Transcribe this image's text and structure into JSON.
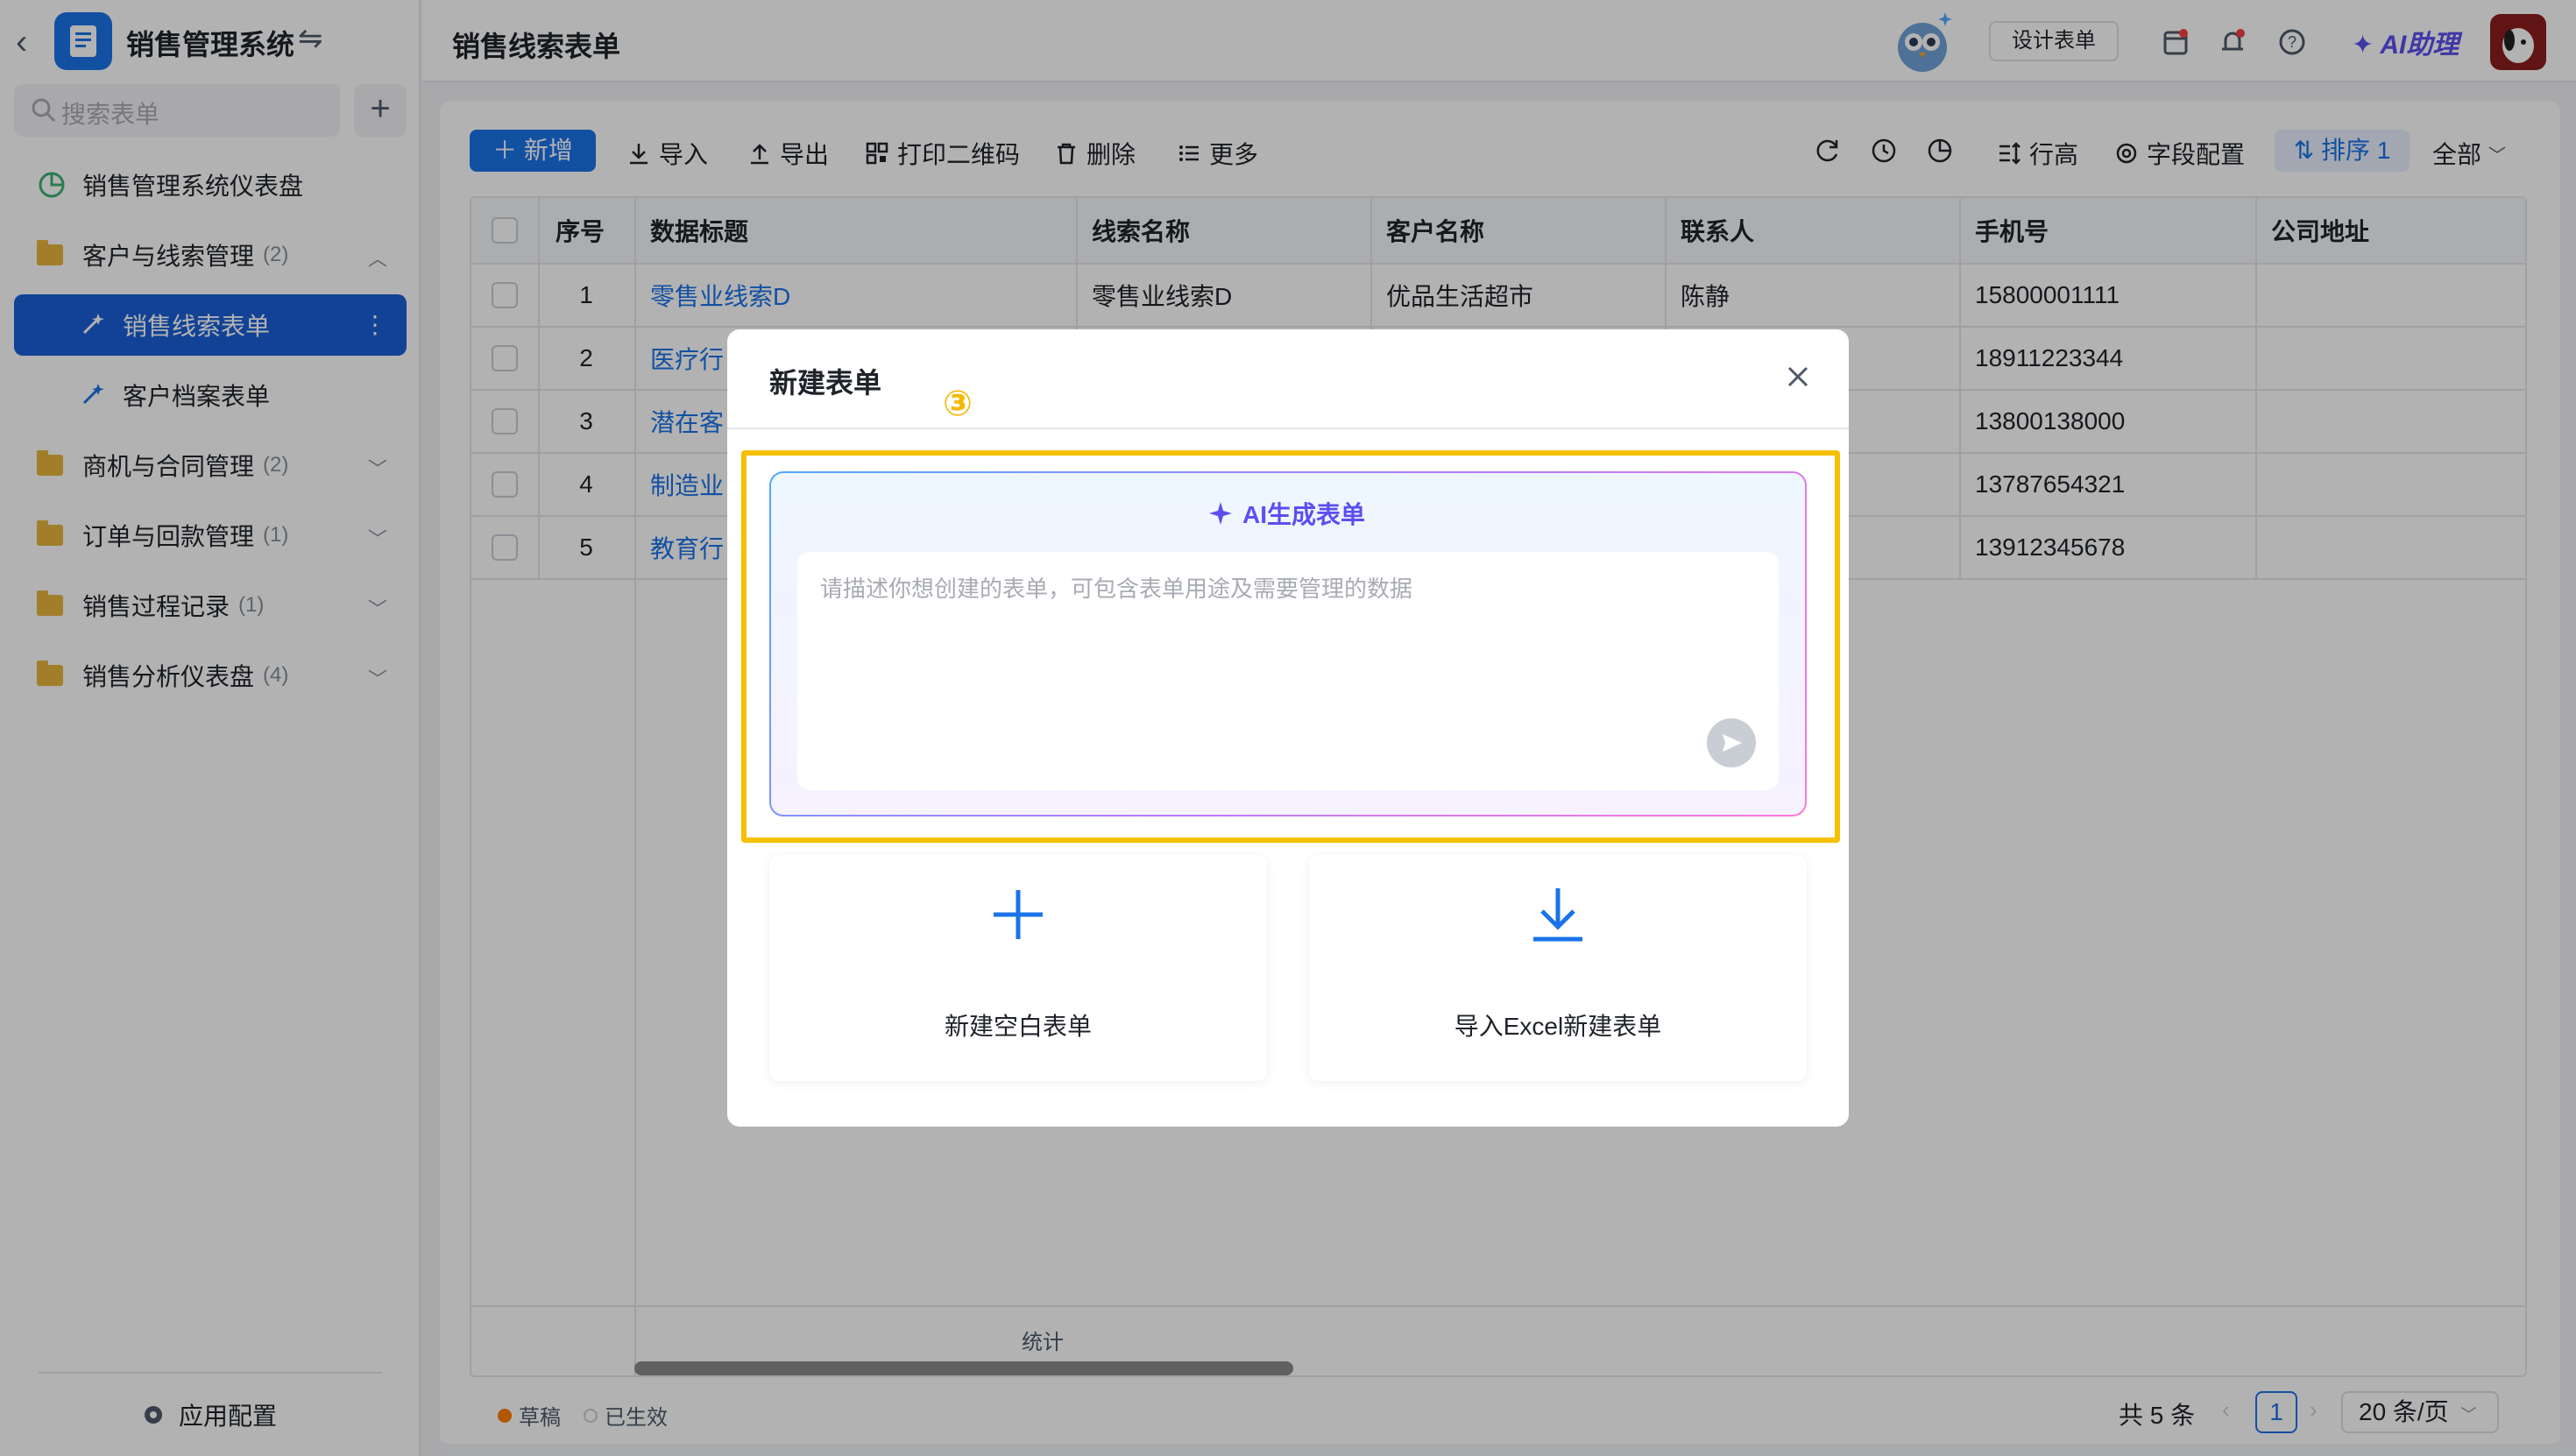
{
  "app": {
    "title": "销售管理系统",
    "search_placeholder": "搜索表单",
    "footer_label": "应用配置"
  },
  "sidebar": {
    "items": [
      {
        "label": "销售管理系统仪表盘",
        "count": ""
      },
      {
        "label": "客户与线索管理",
        "count": "(2)"
      },
      {
        "label": "销售线索表单",
        "count": ""
      },
      {
        "label": "客户档案表单",
        "count": ""
      },
      {
        "label": "商机与合同管理",
        "count": "(2)"
      },
      {
        "label": "订单与回款管理",
        "count": "(1)"
      },
      {
        "label": "销售过程记录",
        "count": "(1)"
      },
      {
        "label": "销售分析仪表盘",
        "count": "(4)"
      }
    ]
  },
  "header": {
    "page_title": "销售线索表单",
    "design_button": "设计表单",
    "ai_assistant": "AI助理"
  },
  "toolbar": {
    "new": "＋ 新增",
    "import": "导入",
    "export": "导出",
    "print_qr": "打印二维码",
    "delete": "删除",
    "more": "更多",
    "row_height": "行高",
    "field_config": "字段配置",
    "sort": "排序 1",
    "filter_all": "全部"
  },
  "table": {
    "columns": [
      "序号",
      "数据标题",
      "线索名称",
      "客户名称",
      "联系人",
      "手机号",
      "公司地址"
    ],
    "rows": [
      [
        "1",
        "零售业线索D",
        "零售业线索D",
        "优品生活超市",
        "陈静",
        "15800001111",
        ""
      ],
      [
        "2",
        "医疗行",
        "",
        "",
        "",
        "18911223344",
        ""
      ],
      [
        "3",
        "潜在客",
        "",
        "",
        "",
        "13800138000",
        ""
      ],
      [
        "4",
        "制造业",
        "",
        "",
        "",
        "13787654321",
        ""
      ],
      [
        "5",
        "教育行",
        "",
        "",
        "",
        "13912345678",
        ""
      ]
    ],
    "stats_label": "统计"
  },
  "footer": {
    "legend_draft": "草稿",
    "legend_active": "已生效",
    "total": "共 5 条",
    "current_page": "1",
    "page_size": "20 条/页"
  },
  "modal": {
    "title": "新建表单",
    "step_marker": "③",
    "ai_title": "AI生成表单",
    "ai_placeholder": "请描述你想创建的表单，可包含表单用途及需要管理的数据",
    "blank_form": "新建空白表单",
    "import_excel": "导入Excel新建表单"
  },
  "colors": {
    "primary": "#1a73e8",
    "sidebar_active": "#1a5fd6",
    "ai_purple": "#5b4ff0",
    "highlight": "#f5c000"
  }
}
